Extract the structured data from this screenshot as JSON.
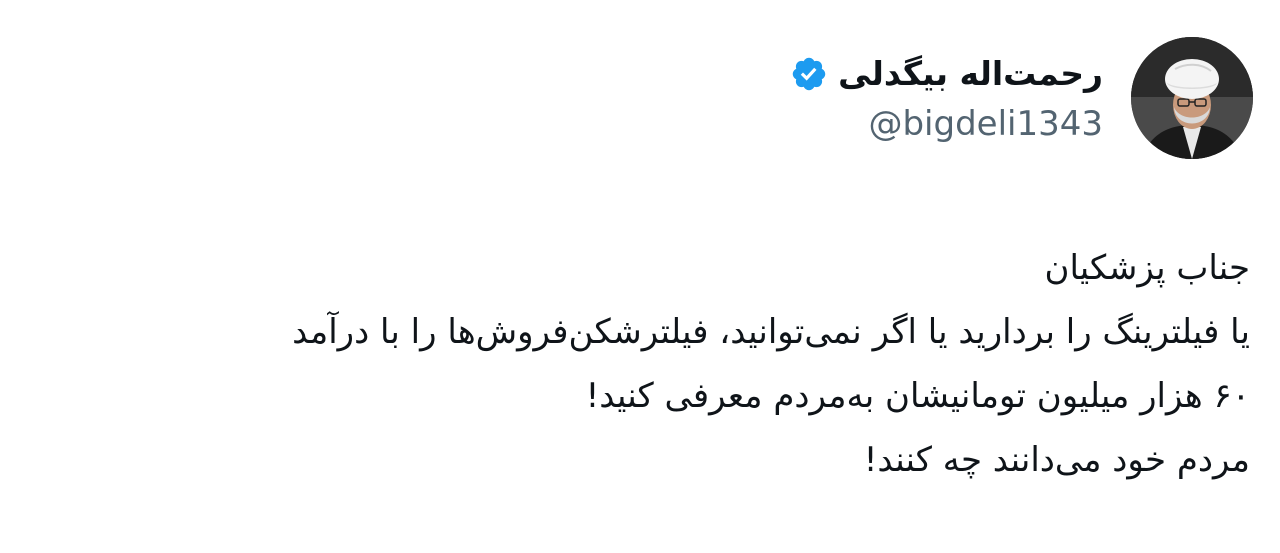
{
  "author": {
    "display_name": "رحمت‌اله بیگدلی",
    "handle": "@bigdeli1343",
    "verified": true,
    "avatar_icon": "profile-photo"
  },
  "tweet": {
    "lines": [
      "جناب پزشکیان",
      "یا فیلترینگ را بردارید یا اگر نمی‌توانید، فیلترشکن‌فروش‌ها را با درآمد",
      "۶۰ هزار میلیون تومانیشان به‌مردم معرفی کنید!",
      "مردم خود می‌دانند چه کنند!"
    ]
  },
  "colors": {
    "text": "#0f1419",
    "secondary": "#536471",
    "verified_badge": "#1d9bf0",
    "background": "#ffffff"
  }
}
